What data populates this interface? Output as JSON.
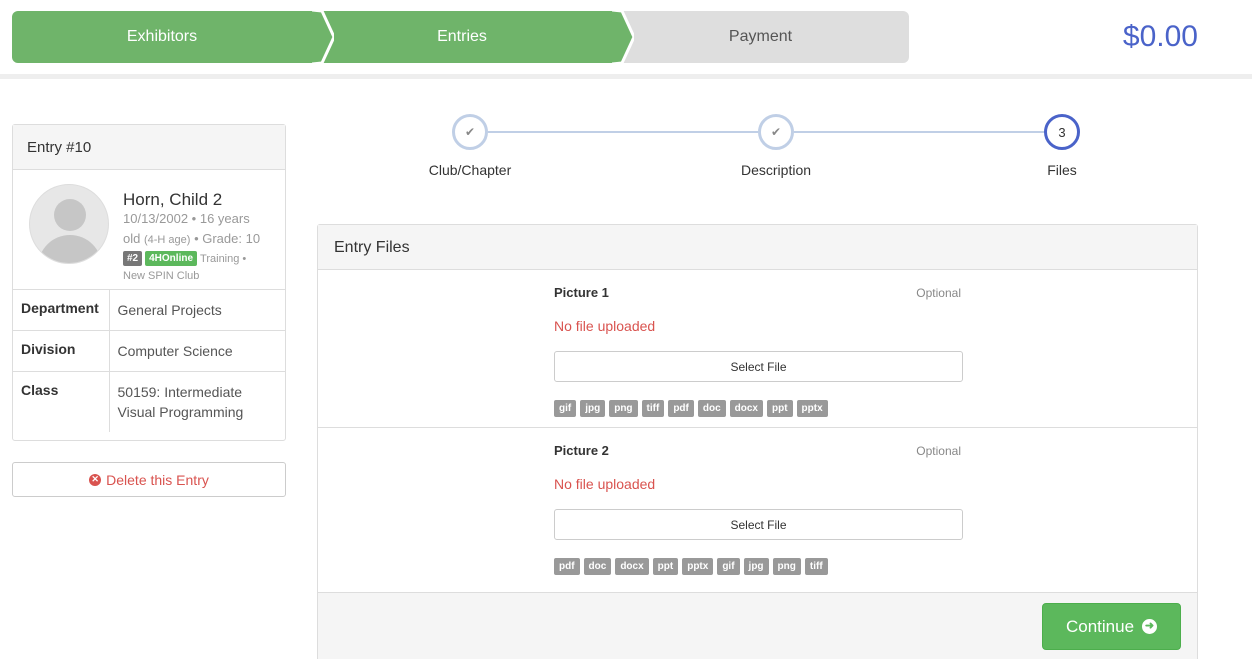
{
  "progress": {
    "steps": [
      {
        "label": "Exhibitors",
        "state": "complete"
      },
      {
        "label": "Entries",
        "state": "active"
      },
      {
        "label": "Payment",
        "state": "pending"
      }
    ],
    "total": "$0.00"
  },
  "entry": {
    "title": "Entry #10",
    "exhibitor": {
      "name": "Horn, Child 2",
      "dob_age": "10/13/2002 • 16 years",
      "age_prefix": "old",
      "age_note": "(4-H age)",
      "grade": "• Grade: 10",
      "tag_number": "#2",
      "tag_source": "4HOnline",
      "training": "Training •",
      "club": "New SPIN Club"
    },
    "details": [
      {
        "label": "Department",
        "value": "General Projects"
      },
      {
        "label": "Division",
        "value": "Computer Science"
      },
      {
        "label": "Class",
        "value": "50159: Intermediate Visual Programming"
      }
    ],
    "delete_label": "Delete this Entry"
  },
  "wizard": {
    "steps": [
      {
        "label": "Club/Chapter",
        "state": "done",
        "marker": "✔"
      },
      {
        "label": "Description",
        "state": "done",
        "marker": "✔"
      },
      {
        "label": "Files",
        "state": "active",
        "marker": "3"
      }
    ]
  },
  "files_panel": {
    "title": "Entry Files",
    "files": [
      {
        "title": "Picture 1",
        "optional_label": "Optional",
        "status": "No file uploaded",
        "button_label": "Select File",
        "types": [
          "gif",
          "jpg",
          "png",
          "tiff",
          "pdf",
          "doc",
          "docx",
          "ppt",
          "pptx"
        ]
      },
      {
        "title": "Picture 2",
        "optional_label": "Optional",
        "status": "No file uploaded",
        "button_label": "Select File",
        "types": [
          "pdf",
          "doc",
          "docx",
          "ppt",
          "pptx",
          "gif",
          "jpg",
          "png",
          "tiff"
        ]
      }
    ],
    "continue_label": "Continue"
  },
  "colors": {
    "complete_green": "#6fb46a",
    "pending_gray": "#dedede",
    "accent_blue": "#4a63c9",
    "danger_red": "#d9534f",
    "button_green": "#5cb85c"
  }
}
